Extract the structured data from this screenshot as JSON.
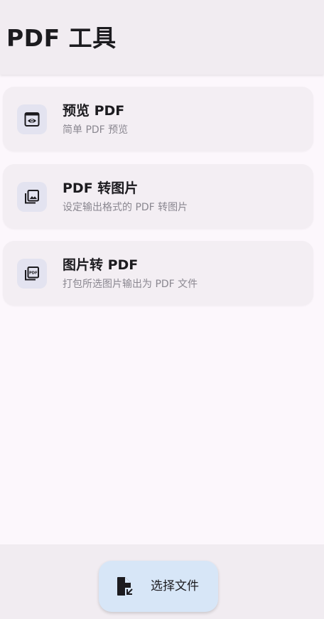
{
  "header": {
    "title": "PDF 工具"
  },
  "tools": [
    {
      "title": "预览 PDF",
      "subtitle": "简单 PDF 预览",
      "icon": "preview-icon"
    },
    {
      "title": "PDF 转图片",
      "subtitle": "设定输出格式的 PDF 转图片",
      "icon": "image-library-icon"
    },
    {
      "title": "图片转 PDF",
      "subtitle": "打包所选图片输出为 PDF 文件",
      "icon": "pdf-document-icon"
    }
  ],
  "fab": {
    "label": "选择文件",
    "icon": "file-open-icon"
  },
  "colors": {
    "background": "#fcf7fc",
    "app_bar": "#f1ecf1",
    "card": "#f3eef3",
    "icon_container": "#e3e3f0",
    "fab": "#d7e6f7",
    "text_primary": "#1c1b1f",
    "text_secondary": "#8a8790"
  }
}
